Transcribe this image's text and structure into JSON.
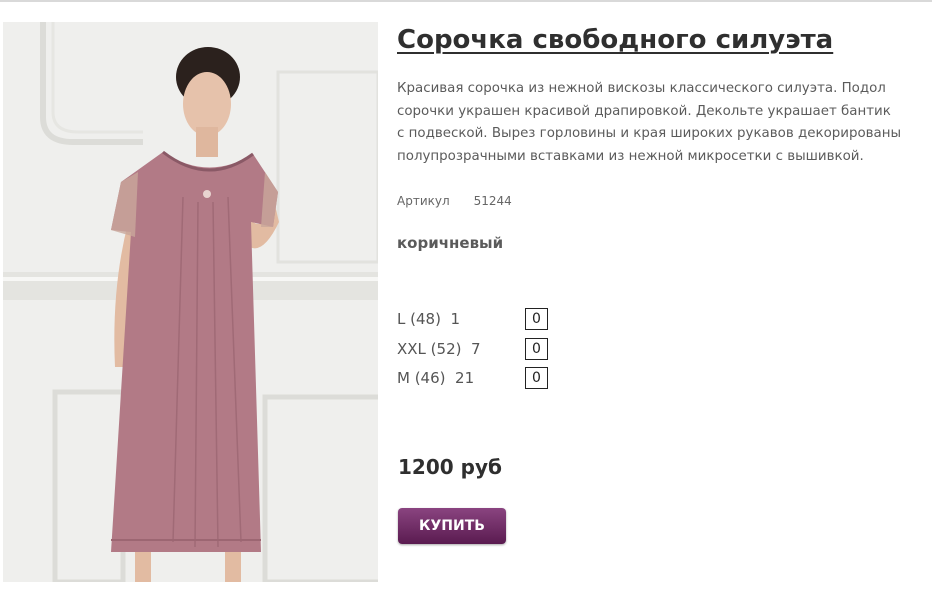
{
  "product": {
    "title": "Сорочка свободного силуэта",
    "description": "Красивая сорочка из нежной вискозы классического силуэта. Подол сорочки украшен красивой драпировкой. Декольте украшает бантик с подвеской. Вырез горловины и края широких рукавов декорированы полупрозрачными вставками из нежной микросетки с вышивкой.",
    "sku_label": "Артикул",
    "sku_value": "51244",
    "color_name": "коричневый",
    "sizes": [
      {
        "label": "L (48)  1",
        "qty": "0"
      },
      {
        "label": "XXL (52)  7",
        "qty": "0"
      },
      {
        "label": "M (46)  21",
        "qty": "0"
      }
    ],
    "price": "1200 руб",
    "buy_label": "КУПИТЬ",
    "dress_color": "#b27a86",
    "button_color": "#6d2a63"
  }
}
